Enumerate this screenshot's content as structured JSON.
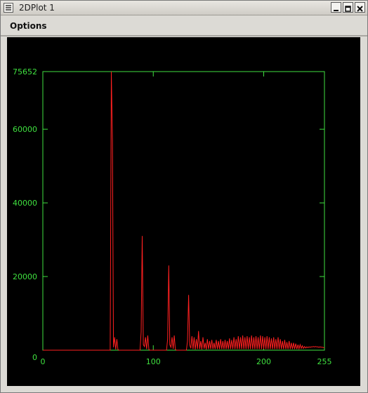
{
  "window": {
    "title": "2DPlot 1"
  },
  "menubar": {
    "options_label": "Options"
  },
  "colors": {
    "axis": "#3fe03f",
    "series": "#ff2020",
    "background": "#000000"
  },
  "chart_data": {
    "type": "line",
    "title": "",
    "xlabel": "",
    "ylabel": "",
    "xlim": [
      0,
      255
    ],
    "ylim": [
      0,
      75652
    ],
    "x_ticks": [
      "0",
      "100",
      "200",
      "255"
    ],
    "y_ticks": [
      "0",
      "20000",
      "40000",
      "60000",
      "75652"
    ],
    "grid": false,
    "series": [
      {
        "points": [
          [
            0,
            0
          ],
          [
            20,
            0
          ],
          [
            40,
            0
          ],
          [
            60,
            0
          ],
          [
            61,
            0
          ],
          [
            62,
            75652
          ],
          [
            63,
            57000
          ],
          [
            64,
            800
          ],
          [
            65,
            3500
          ],
          [
            66,
            200
          ],
          [
            67,
            3000
          ],
          [
            68,
            200
          ],
          [
            69,
            0
          ],
          [
            80,
            0
          ],
          [
            88,
            0
          ],
          [
            89,
            5000
          ],
          [
            90,
            31000
          ],
          [
            91,
            1500
          ],
          [
            92,
            1000
          ],
          [
            93,
            3500
          ],
          [
            94,
            300
          ],
          [
            95,
            4000
          ],
          [
            96,
            200
          ],
          [
            97,
            0
          ],
          [
            110,
            0
          ],
          [
            112,
            0
          ],
          [
            113,
            3000
          ],
          [
            114,
            23000
          ],
          [
            115,
            1500
          ],
          [
            116,
            800
          ],
          [
            117,
            3500
          ],
          [
            118,
            400
          ],
          [
            119,
            4000
          ],
          [
            120,
            200
          ],
          [
            121,
            0
          ],
          [
            128,
            0
          ],
          [
            130,
            0
          ],
          [
            131,
            2500
          ],
          [
            132,
            15000
          ],
          [
            133,
            1500
          ],
          [
            134,
            500
          ],
          [
            135,
            3800
          ],
          [
            136,
            300
          ],
          [
            137,
            3500
          ],
          [
            138,
            200
          ],
          [
            139,
            3000
          ],
          [
            140,
            300
          ],
          [
            141,
            5200
          ],
          [
            142,
            300
          ],
          [
            143,
            2500
          ],
          [
            144,
            200
          ],
          [
            145,
            3500
          ],
          [
            146,
            400
          ],
          [
            147,
            2000
          ],
          [
            148,
            200
          ],
          [
            149,
            3000
          ],
          [
            150,
            300
          ],
          [
            151,
            2500
          ],
          [
            152,
            300
          ],
          [
            153,
            2800
          ],
          [
            154,
            300
          ],
          [
            155,
            2000
          ],
          [
            156,
            300
          ],
          [
            157,
            2800
          ],
          [
            158,
            300
          ],
          [
            159,
            2500
          ],
          [
            160,
            300
          ],
          [
            161,
            3000
          ],
          [
            162,
            300
          ],
          [
            163,
            2500
          ],
          [
            164,
            300
          ],
          [
            165,
            2800
          ],
          [
            166,
            300
          ],
          [
            167,
            2500
          ],
          [
            168,
            300
          ],
          [
            169,
            3200
          ],
          [
            170,
            300
          ],
          [
            171,
            2800
          ],
          [
            172,
            300
          ],
          [
            173,
            3500
          ],
          [
            174,
            300
          ],
          [
            175,
            3000
          ],
          [
            176,
            300
          ],
          [
            177,
            3800
          ],
          [
            178,
            300
          ],
          [
            179,
            3500
          ],
          [
            180,
            300
          ],
          [
            181,
            4000
          ],
          [
            182,
            300
          ],
          [
            183,
            3500
          ],
          [
            184,
            300
          ],
          [
            185,
            3800
          ],
          [
            186,
            300
          ],
          [
            187,
            3500
          ],
          [
            188,
            300
          ],
          [
            189,
            4000
          ],
          [
            190,
            300
          ],
          [
            191,
            3500
          ],
          [
            192,
            300
          ],
          [
            193,
            3800
          ],
          [
            194,
            300
          ],
          [
            195,
            3500
          ],
          [
            196,
            300
          ],
          [
            197,
            4000
          ],
          [
            198,
            300
          ],
          [
            199,
            3800
          ],
          [
            200,
            300
          ],
          [
            201,
            3500
          ],
          [
            202,
            300
          ],
          [
            203,
            3800
          ],
          [
            204,
            300
          ],
          [
            205,
            3500
          ],
          [
            206,
            300
          ],
          [
            207,
            3200
          ],
          [
            208,
            300
          ],
          [
            209,
            3500
          ],
          [
            210,
            300
          ],
          [
            211,
            3000
          ],
          [
            212,
            300
          ],
          [
            213,
            3500
          ],
          [
            214,
            300
          ],
          [
            215,
            3000
          ],
          [
            216,
            300
          ],
          [
            217,
            2500
          ],
          [
            218,
            300
          ],
          [
            219,
            2800
          ],
          [
            220,
            300
          ],
          [
            221,
            2200
          ],
          [
            222,
            300
          ],
          [
            223,
            2500
          ],
          [
            224,
            300
          ],
          [
            225,
            2000
          ],
          [
            226,
            300
          ],
          [
            227,
            2000
          ],
          [
            228,
            300
          ],
          [
            229,
            1800
          ],
          [
            230,
            300
          ],
          [
            231,
            1500
          ],
          [
            232,
            400
          ],
          [
            233,
            1500
          ],
          [
            234,
            500
          ],
          [
            235,
            1200
          ],
          [
            236,
            500
          ],
          [
            237,
            1000
          ],
          [
            238,
            600
          ],
          [
            239,
            900
          ],
          [
            240,
            700
          ],
          [
            241,
            900
          ],
          [
            242,
            800
          ],
          [
            243,
            900
          ],
          [
            244,
            900
          ],
          [
            245,
            1000
          ],
          [
            246,
            900
          ],
          [
            247,
            1000
          ],
          [
            248,
            900
          ],
          [
            249,
            900
          ],
          [
            250,
            800
          ],
          [
            251,
            900
          ],
          [
            252,
            800
          ],
          [
            253,
            800
          ],
          [
            254,
            700
          ],
          [
            255,
            700
          ]
        ]
      }
    ]
  }
}
